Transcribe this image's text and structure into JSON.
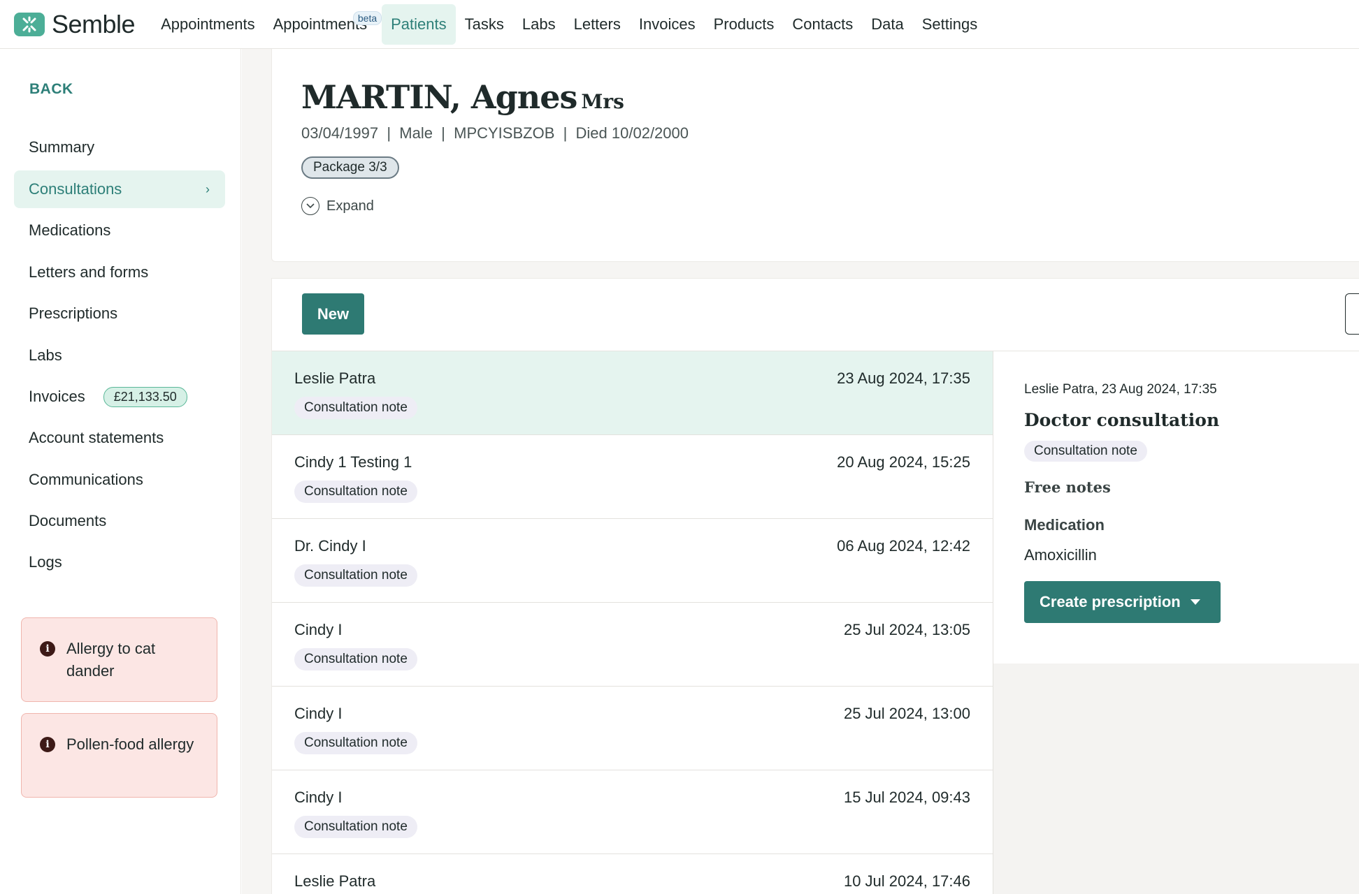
{
  "brand": {
    "name": "Semble",
    "accent": "#2e7a73",
    "logo_color": "#4cae97"
  },
  "nav": {
    "items": [
      {
        "label": "Appointments",
        "active": false
      },
      {
        "label": "Appointments",
        "badge": "beta",
        "active": false
      },
      {
        "label": "Patients",
        "active": true
      },
      {
        "label": "Tasks",
        "active": false
      },
      {
        "label": "Labs",
        "active": false
      },
      {
        "label": "Letters",
        "active": false
      },
      {
        "label": "Invoices",
        "active": false
      },
      {
        "label": "Products",
        "active": false
      },
      {
        "label": "Contacts",
        "active": false
      },
      {
        "label": "Data",
        "active": false
      },
      {
        "label": "Settings",
        "active": false
      }
    ]
  },
  "sidebar": {
    "back_label": "BACK",
    "items": [
      {
        "label": "Summary"
      },
      {
        "label": "Consultations",
        "active": true,
        "chevron": "›"
      },
      {
        "label": "Medications"
      },
      {
        "label": "Letters and forms"
      },
      {
        "label": "Prescriptions"
      },
      {
        "label": "Labs"
      },
      {
        "label": "Invoices",
        "badge": "£21,133.50"
      },
      {
        "label": "Account statements"
      },
      {
        "label": "Communications"
      },
      {
        "label": "Documents"
      },
      {
        "label": "Logs"
      }
    ],
    "alerts": [
      {
        "icon": "info-icon",
        "glyph": "i",
        "text": "Allergy to cat dander"
      },
      {
        "icon": "info-icon",
        "glyph": "i",
        "text": "Pollen-food allergy"
      }
    ]
  },
  "patient": {
    "name": "MARTIN, Agnes",
    "title": "Mrs",
    "meta": "03/04/1997  |  Male  |  MPCYISBZOB  |  Died 10/02/2000",
    "package": "Package 3/3",
    "expand_label": "Expand"
  },
  "consultations": {
    "new_label": "New",
    "rows": [
      {
        "who": "Leslie Patra",
        "when": "23 Aug 2024, 17:35",
        "type": "Consultation note",
        "selected": true
      },
      {
        "who": "Cindy 1 Testing 1",
        "when": "20 Aug 2024, 15:25",
        "type": "Consultation note"
      },
      {
        "who": "Dr. Cindy I",
        "when": "06 Aug 2024, 12:42",
        "type": "Consultation note"
      },
      {
        "who": "Cindy I",
        "when": "25 Jul 2024, 13:05",
        "type": "Consultation note"
      },
      {
        "who": "Cindy I",
        "when": "25 Jul 2024, 13:00",
        "type": "Consultation note"
      },
      {
        "who": "Cindy I",
        "when": "15 Jul 2024, 09:43",
        "type": "Consultation note"
      },
      {
        "who": "Leslie Patra",
        "when": "10 Jul 2024, 17:46",
        "type": ""
      }
    ]
  },
  "detail": {
    "header": "Leslie Patra, 23 Aug 2024, 17:35",
    "title": "Doctor consultation",
    "type": "Consultation note",
    "free_notes_label": "Free notes",
    "medication_label": "Medication",
    "medication_value": "Amoxicillin",
    "create_label": "Create prescription"
  }
}
